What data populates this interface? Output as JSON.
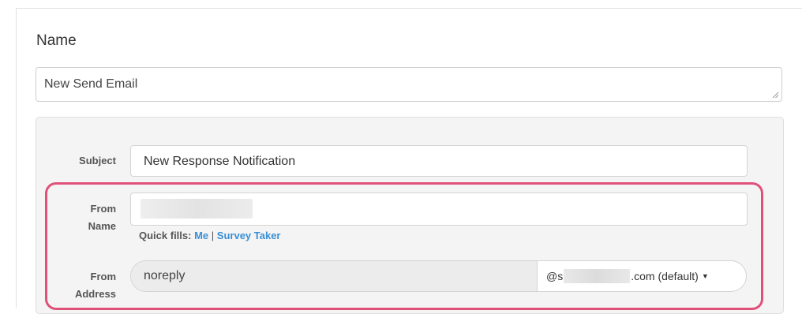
{
  "form": {
    "name_heading": "Name",
    "name_value": "New Send Email",
    "subject": {
      "label": "Subject",
      "value": "New Response Notification"
    },
    "from_name": {
      "label_line1": "From",
      "label_line2": "Name",
      "value": "",
      "quick_fills": {
        "label": "Quick fills:",
        "options": [
          "Me",
          "Survey Taker"
        ],
        "separator": "|"
      }
    },
    "from_address": {
      "label_line1": "From",
      "label_line2": "Address",
      "local_part": "noreply",
      "domain_prefix": "@s",
      "domain_suffix": ".com (default)"
    }
  },
  "colors": {
    "highlight": "#e0517a",
    "link": "#3a8fd6",
    "panel_bg": "#f4f4f4"
  },
  "icons": {
    "resize": "resize-grip-icon",
    "dropdown": "caret-down-icon"
  }
}
